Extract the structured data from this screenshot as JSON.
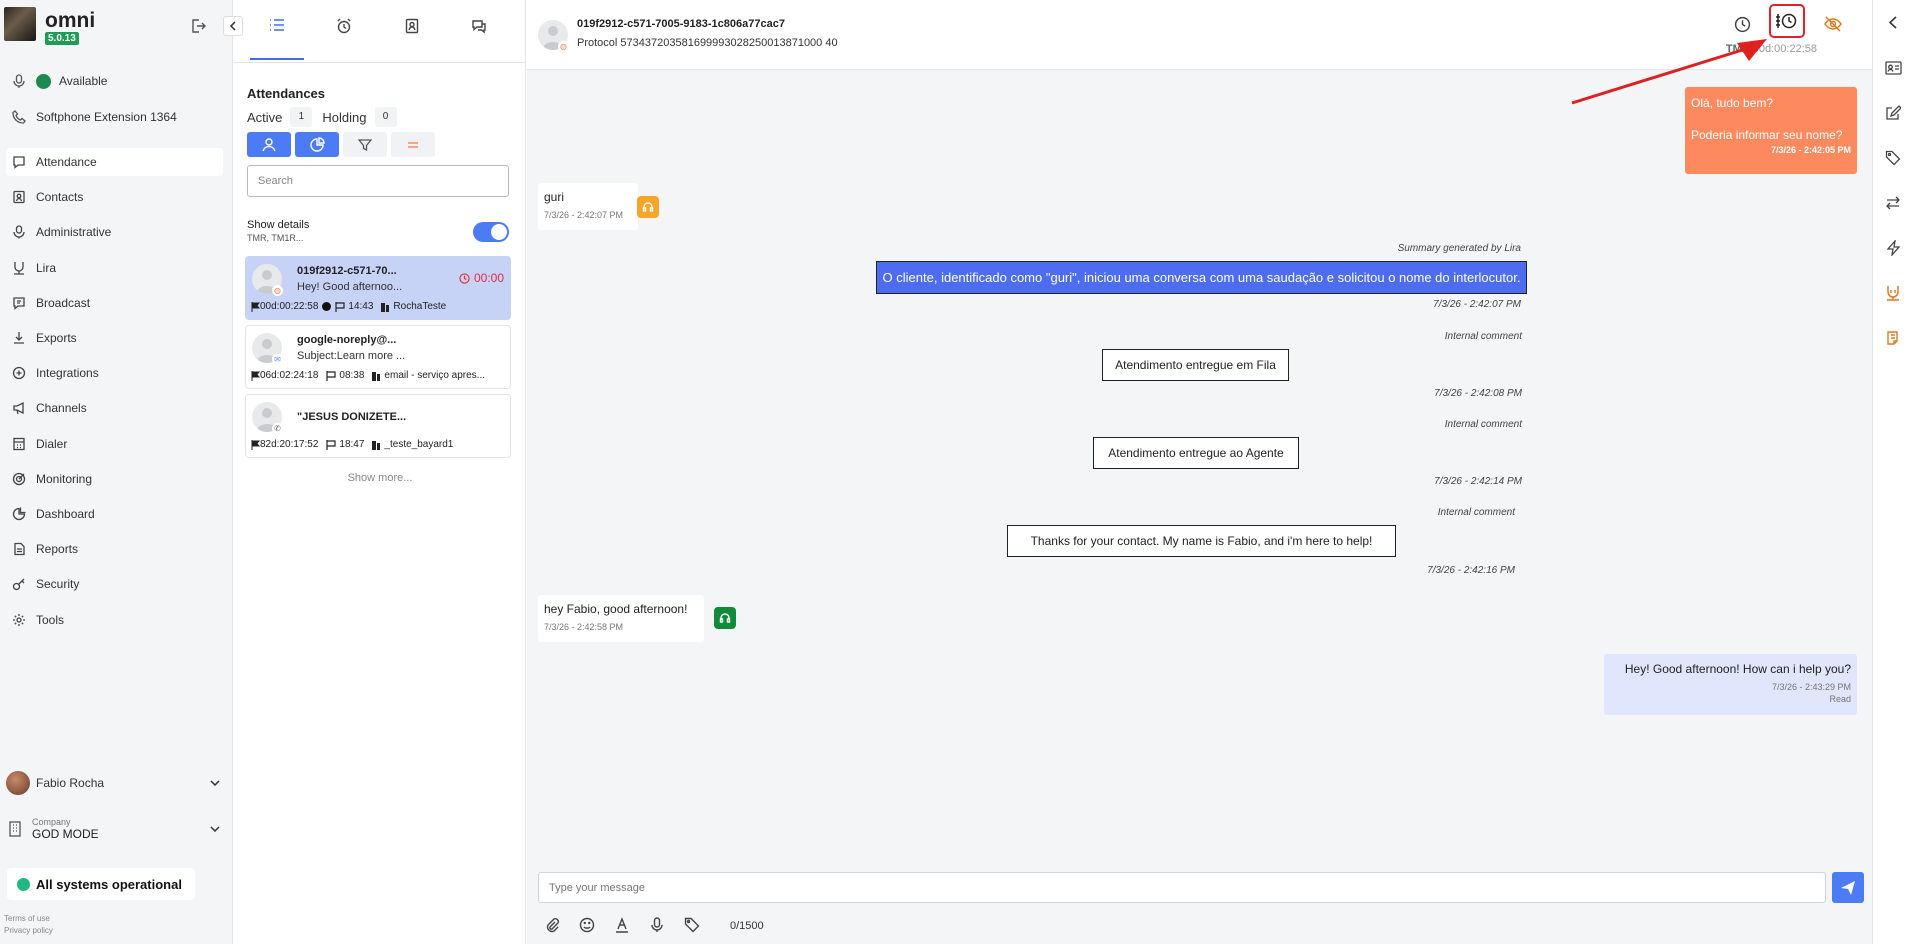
{
  "app": {
    "name": "omni",
    "version": "5.0.13"
  },
  "sidebar": {
    "status": "Available",
    "softphone": "Softphone Extension 1364",
    "items": [
      {
        "label": "Attendance",
        "icon": "chat-icon"
      },
      {
        "label": "Contacts",
        "icon": "contacts-icon"
      },
      {
        "label": "Administrative",
        "icon": "admin-icon"
      },
      {
        "label": "Lira",
        "icon": "lira-icon"
      },
      {
        "label": "Broadcast",
        "icon": "broadcast-icon"
      },
      {
        "label": "Exports",
        "icon": "download-icon"
      },
      {
        "label": "Integrations",
        "icon": "integrations-icon"
      },
      {
        "label": "Channels",
        "icon": "megaphone-icon"
      },
      {
        "label": "Dialer",
        "icon": "dialer-icon"
      },
      {
        "label": "Monitoring",
        "icon": "target-icon"
      },
      {
        "label": "Dashboard",
        "icon": "pie-icon"
      },
      {
        "label": "Reports",
        "icon": "report-icon"
      },
      {
        "label": "Security",
        "icon": "key-icon"
      },
      {
        "label": "Tools",
        "icon": "gear-icon"
      }
    ],
    "user": "Fabio Rocha",
    "company_label": "Company",
    "company_name": "GOD MODE",
    "system_status": "All systems operational",
    "terms": "Terms of use",
    "privacy": "Privacy policy"
  },
  "list": {
    "title": "Attendances",
    "active_label": "Active",
    "active_count": "1",
    "holding_label": "Holding",
    "holding_count": "0",
    "search_placeholder": "Search",
    "show_details": "Show details",
    "show_details_sub": "TMR, TM1R...",
    "show_more": "Show more...",
    "conversations": [
      {
        "name": "019f2912-c571-70...",
        "preview": "Hey! Good afternoo...",
        "timer": "00:00",
        "duration": "00d:00:22:58",
        "time": "14:43",
        "queue": "RochaTeste",
        "channel": "chat"
      },
      {
        "name": "google-noreply@...",
        "preview": "Subject:Learn more ...",
        "duration": "06d:02:24:18",
        "time": "08:38",
        "queue": "email - serviço apres...",
        "channel": "email"
      },
      {
        "name": "\"JESUS DONIZETE...",
        "preview": "",
        "duration": "82d:20:17:52",
        "time": "18:47",
        "queue": "_teste_bayard1",
        "channel": "phone"
      }
    ]
  },
  "chat": {
    "id": "019f2912-c571-7005-9183-1c806a77cac7",
    "protocol": "Protocol 573437203581699993028250013871000 40",
    "tma_label": "TMA",
    "tma_value": "00d:00:22:58",
    "messages": {
      "out1_line1": "Olá, tudo bem?",
      "out1_line2": "Poderia informar seu nome?",
      "out1_time": "7/3/26 - 2:42:05 PM",
      "in1_text": "guri",
      "in1_time": "7/3/26 - 2:42:07 PM",
      "summary_label": "Summary generated by Lira",
      "summary_text": "O cliente, identificado como \"guri\", iniciou uma conversa com uma saudação e solicitou o nome do interlocutor.",
      "summary_time": "7/3/26 - 2:42:07 PM",
      "ic1_label": "Internal comment",
      "ic1_text": "Atendimento entregue em Fila",
      "ic1_time": "7/3/26 - 2:42:08 PM",
      "ic2_label": "Internal comment",
      "ic2_text": "Atendimento entregue ao Agente",
      "ic2_time": "7/3/26 - 2:42:14 PM",
      "ic3_label": "Internal comment",
      "ic3_text": "Thanks for your contact. My name is Fabio, and i'm here to help!",
      "ic3_time": "7/3/26 - 2:42:16 PM",
      "in2_text": "hey Fabio, good afternoon!",
      "in2_time": "7/3/26 - 2:42:58 PM",
      "out2_text": "Hey! Good afternoon! How can i help you?",
      "out2_time": "7/3/26 - 2:43:29 PM",
      "out2_status": "Read"
    },
    "composer_placeholder": "Type your message",
    "char_count": "0/1500"
  },
  "colors": {
    "primary": "#4d7bf3",
    "outgoing": "#fd8a5e",
    "summary": "#4d6cf0",
    "timer": "#e0303a",
    "status_ok": "#1eb980"
  }
}
